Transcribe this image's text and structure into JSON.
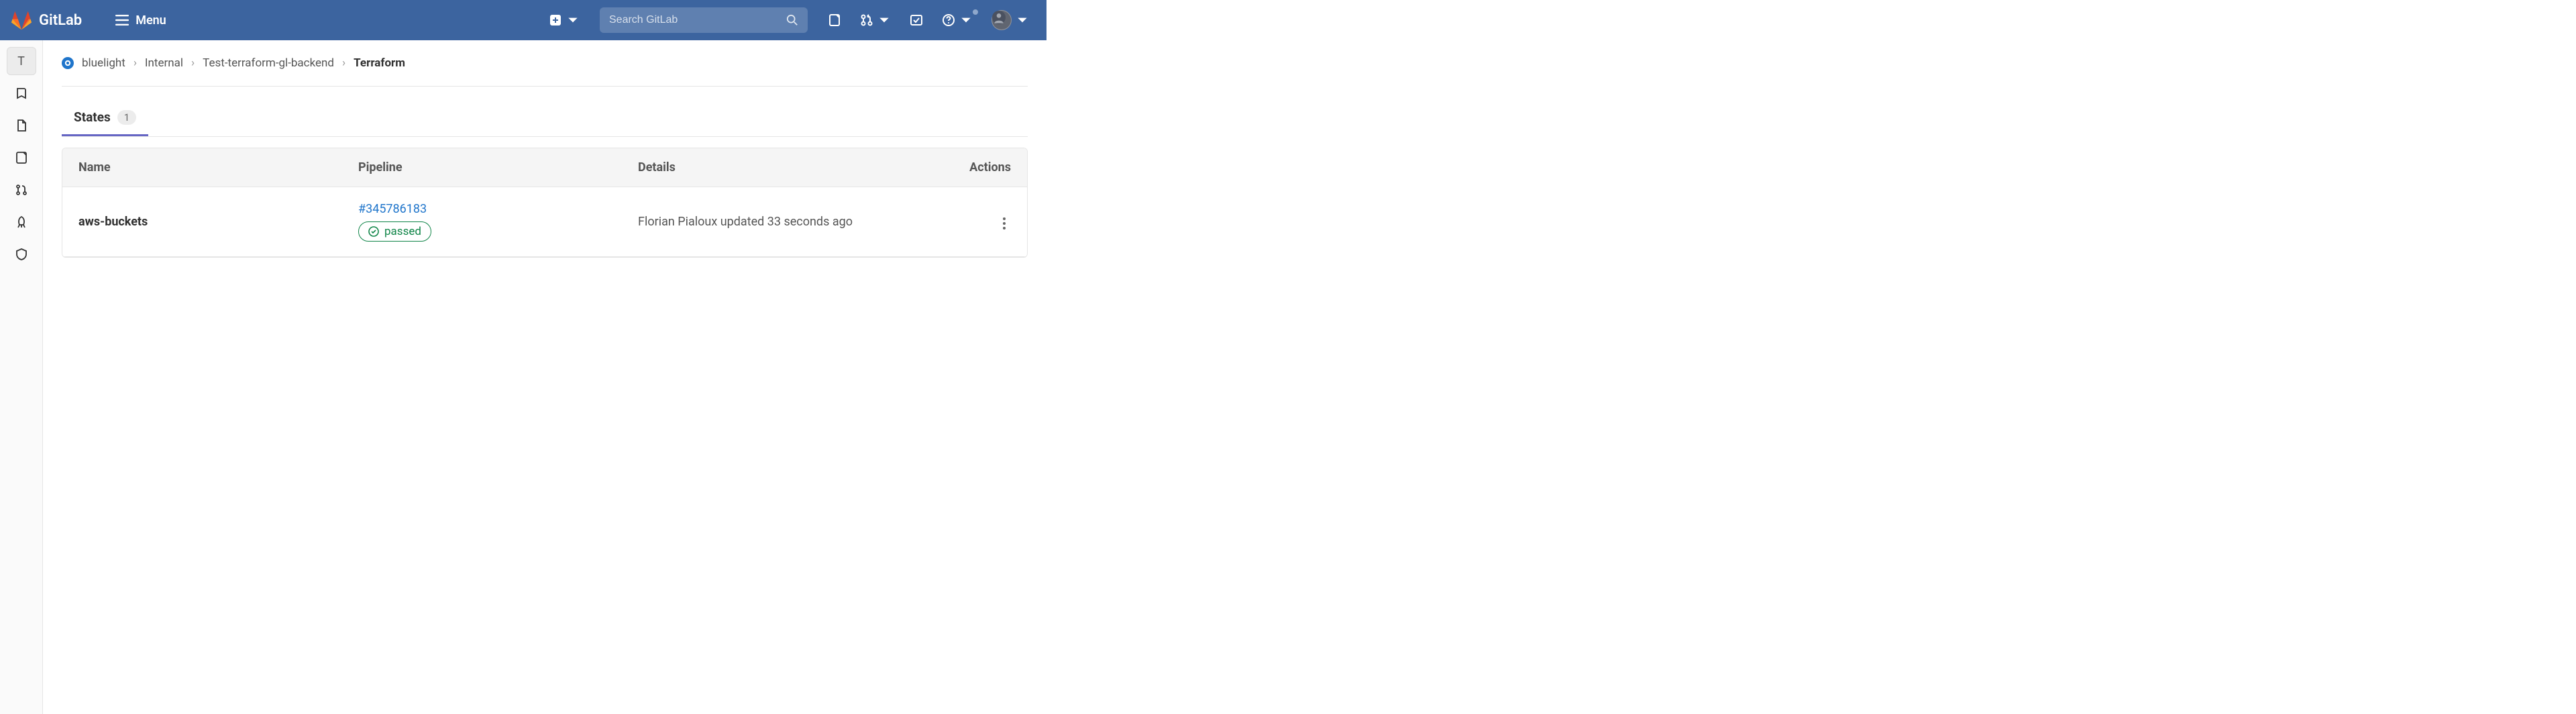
{
  "header": {
    "brand": "GitLab",
    "menu_label": "Menu",
    "search_placeholder": "Search GitLab"
  },
  "sidebar": {
    "project_letter": "T"
  },
  "breadcrumb": {
    "items": [
      "bluelight",
      "Internal",
      "Test-terraform-gl-backend"
    ],
    "current": "Terraform"
  },
  "tabs": {
    "states": {
      "label": "States",
      "count": "1"
    }
  },
  "table": {
    "columns": {
      "name": "Name",
      "pipeline": "Pipeline",
      "details": "Details",
      "actions": "Actions"
    },
    "rows": [
      {
        "name": "aws-buckets",
        "pipeline_id": "#345786183",
        "pipeline_status": "passed",
        "details": "Florian Pialoux updated 33 seconds ago"
      }
    ]
  }
}
